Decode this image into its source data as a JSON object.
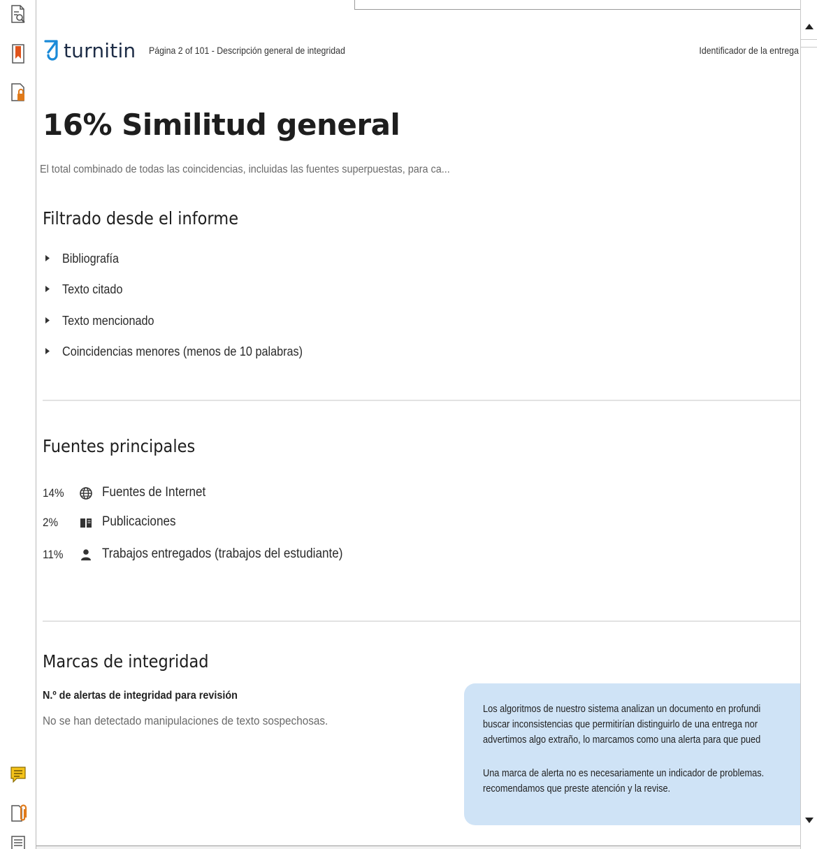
{
  "header": {
    "logo_text": "turnitin",
    "page_info": "Página 2 of 101 - Descripción general de integridad",
    "submission_id_label": "Identificador de la entrega"
  },
  "summary": {
    "title": "16% Similitud general",
    "subtitle": "El total combinado de todas las coincidencias, incluidas las fuentes superpuestas, para ca..."
  },
  "filtered": {
    "heading": "Filtrado desde el informe",
    "items": [
      "Bibliografía",
      "Texto citado",
      "Texto mencionado",
      "Coincidencias menores (menos de 10 palabras)"
    ]
  },
  "sources": {
    "heading": "Fuentes principales",
    "items": [
      {
        "percent": "14%",
        "icon": "globe-icon",
        "label": "Fuentes de Internet"
      },
      {
        "percent": "2%",
        "icon": "book-icon",
        "label": "Publicaciones"
      },
      {
        "percent": "11%",
        "icon": "person-icon",
        "label": "Trabajos entregados (trabajos del estudiante)"
      }
    ]
  },
  "integrity": {
    "heading": "Marcas de integridad",
    "alerts_heading": "N.º de alertas de integridad para revisión",
    "alerts_status": "No se han detectado manipulaciones de texto sospechosas.",
    "info_lines_1": [
      "Los algoritmos de nuestro sistema analizan un documento en profundi",
      "buscar inconsistencias que permitirían distinguirlo de una entrega nor",
      "advertimos algo extraño, lo marcamos como una alerta para que pued"
    ],
    "info_lines_2": [
      "Una marca de alerta no es necesariamente un indicador de problemas.",
      "recomendamos que preste atención y la revise."
    ]
  },
  "colors": {
    "logo_blue": "#1a8ad8",
    "logo_text": "#1d2c46",
    "info_box_bg": "#cfe3f6",
    "bookmark_orange": "#e0541c",
    "comment_yellow": "#f4c21a",
    "attachment_orange": "#e07a1a"
  }
}
